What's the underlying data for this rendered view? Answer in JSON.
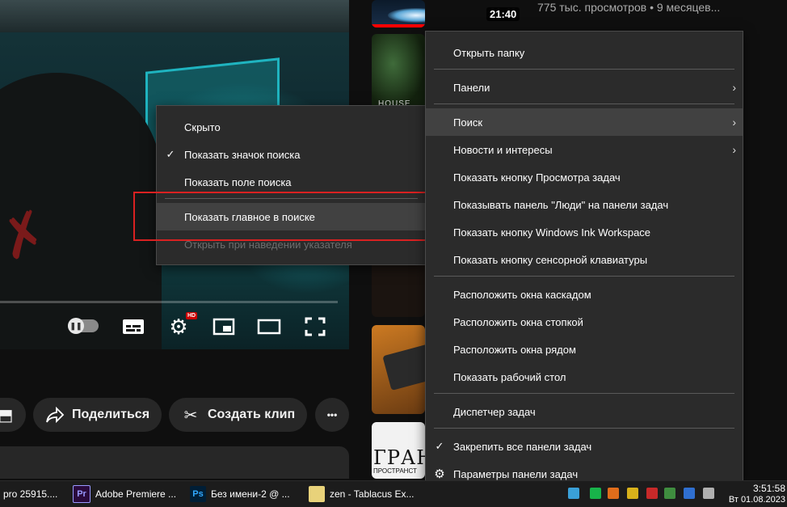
{
  "player": {
    "hd_badge": "HD",
    "icons": {
      "pause": "pause-icon",
      "subtitles": "subtitles-icon",
      "settings": "gear-icon",
      "miniplayer": "miniplayer-icon",
      "theater": "theater-mode-icon",
      "fullscreen": "fullscreen-icon"
    }
  },
  "actions": {
    "share_label": "Поделиться",
    "clip_label": "Создать клип",
    "more_label": "•••"
  },
  "sidebar": {
    "video1": {
      "duration": "21:40",
      "meta": "775 тыс. просмотров • 9 месяцев..."
    },
    "video2": {
      "thumb_text": "HOUSE"
    },
    "video5": {
      "thumb_text": "ГРАН",
      "thumb_sub": "ПРОСТРАНСТ"
    }
  },
  "search_submenu": {
    "items": [
      {
        "label": "Скрыто",
        "checked": false
      },
      {
        "label": "Показать значок поиска",
        "checked": true
      },
      {
        "label": "Показать поле поиска",
        "checked": false
      },
      {
        "label": "Показать главное в поиске",
        "checked": false,
        "hover": true
      },
      {
        "label": "Открыть при наведении указателя",
        "disabled": true
      }
    ],
    "check_glyph": "✓"
  },
  "context_menu": {
    "items": [
      {
        "label": "Открыть папку"
      },
      {
        "label": "Панели",
        "submenu": true
      },
      {
        "label": "Поиск",
        "submenu": true,
        "hover": true
      },
      {
        "label": "Новости и интересы",
        "submenu": true
      },
      {
        "label": "Показать кнопку Просмотра задач"
      },
      {
        "label": "Показывать панель \"Люди\" на панели задач"
      },
      {
        "label": "Показать кнопку Windows Ink Workspace"
      },
      {
        "label": "Показать кнопку сенсорной клавиатуры"
      },
      {
        "label": "Расположить окна каскадом"
      },
      {
        "label": "Расположить окна стопкой"
      },
      {
        "label": "Расположить окна рядом"
      },
      {
        "label": "Показать рабочий стол"
      },
      {
        "label": "Диспетчер задач"
      },
      {
        "label": "Закрепить все панели задач",
        "checked": true
      },
      {
        "label": "Параметры панели задач",
        "icon": "gear-icon"
      }
    ],
    "arrow_glyph": "›",
    "check_glyph": "✓",
    "gear_glyph": "⚙"
  },
  "taskbar": {
    "tasks": [
      {
        "label": "pro 25915...."
      },
      {
        "icon_text": "Pr",
        "label": "Adobe Premiere ...",
        "color": "#2a0a3d",
        "accent": "#9999ff"
      },
      {
        "icon_text": "Ps",
        "label": "Без имени-2 @ ...",
        "color": "#001e36",
        "accent": "#31a8ff"
      },
      {
        "icon_text": "",
        "label": "zen - Tablacus Ex...",
        "color": "#e8d27a"
      }
    ],
    "time": "3:51:58",
    "date": "Вт 01.08.2023"
  }
}
